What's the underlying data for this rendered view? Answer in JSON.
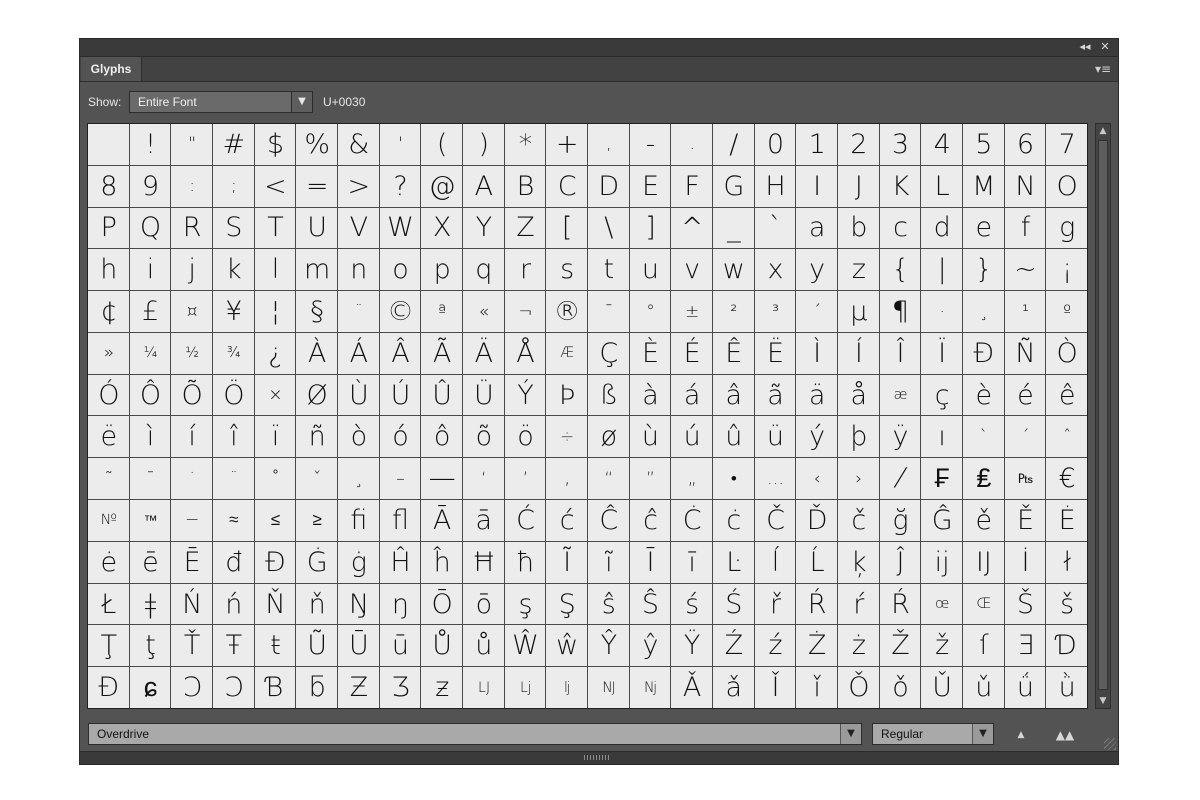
{
  "panel": {
    "title": "Glyphs",
    "collapse_icon": "◂◂",
    "close_icon": "✕",
    "menu_icon": "▾≡"
  },
  "show": {
    "label": "Show:",
    "value": "Entire Font",
    "unicode": "U+0030"
  },
  "footer": {
    "font_family": "Overdrive",
    "font_style": "Regular",
    "zoom_out_icon": "▲",
    "zoom_in_icon": "▲▲"
  },
  "glyphs": [
    "",
    "!",
    "\"",
    "#",
    "$",
    "%",
    "&",
    "'",
    "(",
    ")",
    "*",
    "+",
    ",",
    "-",
    ".",
    "/",
    "0",
    "1",
    "2",
    "3",
    "4",
    "5",
    "6",
    "7",
    "8",
    "9",
    ":",
    ";",
    "<",
    "=",
    ">",
    "?",
    "@",
    "A",
    "B",
    "C",
    "D",
    "E",
    "F",
    "G",
    "H",
    "I",
    "J",
    "K",
    "L",
    "M",
    "N",
    "O",
    "P",
    "Q",
    "R",
    "S",
    "T",
    "U",
    "V",
    "W",
    "X",
    "Y",
    "Z",
    "[",
    "\\",
    "]",
    "^",
    "_",
    "`",
    "a",
    "b",
    "c",
    "d",
    "e",
    "f",
    "g",
    "h",
    "i",
    "j",
    "k",
    "l",
    "m",
    "n",
    "o",
    "p",
    "q",
    "r",
    "s",
    "t",
    "u",
    "v",
    "w",
    "x",
    "y",
    "z",
    "{",
    "|",
    "}",
    "~",
    "¡",
    "¢",
    "£",
    "¤",
    "¥",
    "¦",
    "§",
    "¨",
    "©",
    "ª",
    "«",
    "¬",
    "®",
    "¯",
    "°",
    "±",
    "²",
    "³",
    "´",
    "µ",
    "¶",
    "·",
    "¸",
    "¹",
    "º",
    "»",
    "¼",
    "½",
    "¾",
    "¿",
    "À",
    "Á",
    "Â",
    "Ã",
    "Ä",
    "Å",
    "Æ",
    "Ç",
    "È",
    "É",
    "Ê",
    "Ë",
    "Ì",
    "Í",
    "Î",
    "Ï",
    "Ð",
    "Ñ",
    "Ò",
    "Ó",
    "Ô",
    "Õ",
    "Ö",
    "×",
    "Ø",
    "Ù",
    "Ú",
    "Û",
    "Ü",
    "Ý",
    "Þ",
    "ß",
    "à",
    "á",
    "â",
    "ã",
    "ä",
    "å",
    "æ",
    "ç",
    "è",
    "é",
    "ê",
    "ë",
    "ì",
    "í",
    "î",
    "ï",
    "ñ",
    "ò",
    "ó",
    "ô",
    "õ",
    "ö",
    "÷",
    "ø",
    "ù",
    "ú",
    "û",
    "ü",
    "ý",
    "þ",
    "ÿ",
    "ı",
    "ˋ",
    "ˊ",
    "ˆ",
    "˜",
    "¯",
    "˙",
    "¨",
    "˚",
    "ˇ",
    "¸",
    "–",
    "—",
    "‘",
    "’",
    "‚",
    "“",
    "”",
    "„",
    "•",
    "…",
    "‹",
    "›",
    "⁄",
    "₣",
    "₤",
    "₧",
    "€",
    "№",
    "™",
    "−",
    "≈",
    "≤",
    "≥",
    "ﬁ",
    "ﬂ",
    "Ā",
    "ā",
    "Ć",
    "ć",
    "Ĉ",
    "ĉ",
    "Ċ",
    "ċ",
    "Č",
    "Ď",
    "č",
    "ğ",
    "Ĝ",
    "ě",
    "Ě",
    "Ė",
    "ė",
    "ē",
    "Ē",
    "đ",
    "Đ",
    "Ġ",
    "ġ",
    "Ĥ",
    "ĥ",
    "Ħ",
    "ħ",
    "Ĩ",
    "ĩ",
    "Ī",
    "ī",
    "Ŀ",
    "ĺ",
    "Ĺ",
    "ķ",
    "Ĵ",
    "ĳ",
    "Ĳ",
    "İ",
    "ł",
    "Ł",
    "ǂ",
    "Ń",
    "ń",
    "Ň",
    "ň",
    "Ŋ",
    "ŋ",
    "Ō",
    "ō",
    "ş",
    "Ş",
    "ŝ",
    "Ŝ",
    "ś",
    "Ś",
    "ř",
    "Ŕ",
    "ŕ",
    "Ŕ",
    "œ",
    "Œ",
    "Š",
    "š",
    "Ţ",
    "ţ",
    "Ť",
    "Ŧ",
    "ŧ",
    "Ũ",
    "Ū",
    "ū",
    "Ů",
    "ů",
    "Ŵ",
    "ŵ",
    "Ŷ",
    "ŷ",
    "Ÿ",
    "Ź",
    "ź",
    "Ż",
    "ż",
    "Ž",
    "ž",
    "ſ",
    "Ǝ",
    "Ɗ",
    "Ɖ",
    "ɕ",
    "Ɔ",
    "Ɔ",
    "Ɓ",
    "ƃ",
    "Ƶ",
    "Ʒ",
    "ƶ",
    "Ǉ",
    "ǈ",
    "ǉ",
    "Ǌ",
    "ǋ",
    "Ǎ",
    "ǎ",
    "Ǐ",
    "ǐ",
    "Ǒ",
    "ǒ",
    "Ǔ",
    "ǔ",
    "ǘ",
    "ǜ"
  ],
  "colors": {
    "panel_bg": "#535353",
    "cell_bg": "#ececec",
    "grid_line": "#4a4a4a"
  }
}
